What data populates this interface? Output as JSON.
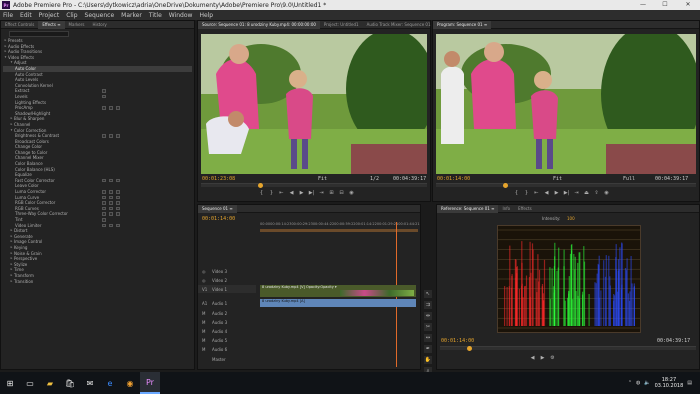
{
  "window": {
    "title": "Adobe Premiere Pro - C:\\Users\\dytkowicz\\adria\\OneDrive\\Dokumenty\\Adobe\\Premiere Pro\\9.0\\Untitled1 *",
    "logo_text": "Pr",
    "minimize": "—",
    "maximize": "☐",
    "close": "✕"
  },
  "menu": [
    "File",
    "Edit",
    "Project",
    "Clip",
    "Sequence",
    "Marker",
    "Title",
    "Window",
    "Help"
  ],
  "effects_panel": {
    "tabs": [
      "Effect Controls",
      "Effects ≡",
      "Markers",
      "History"
    ],
    "active_tab": 1,
    "tree": [
      {
        "label": "Presets",
        "level": 0
      },
      {
        "label": "Audio Effects",
        "level": 0
      },
      {
        "label": "Audio Transitions",
        "level": 0
      },
      {
        "label": "Video Effects",
        "level": 0,
        "open": true
      },
      {
        "label": "Adjust",
        "level": 1,
        "open": true
      },
      {
        "label": "Auto Color",
        "level": 2,
        "selected": true
      },
      {
        "label": "Auto Contrast",
        "level": 2
      },
      {
        "label": "Auto Levels",
        "level": 2
      },
      {
        "label": "Convolution Kernel",
        "level": 2
      },
      {
        "label": "Extract",
        "level": 2,
        "fx": 1
      },
      {
        "label": "Levels",
        "level": 2,
        "fx": 1
      },
      {
        "label": "Lighting Effects",
        "level": 2
      },
      {
        "label": "ProcAmp",
        "level": 2,
        "fx": 3
      },
      {
        "label": "Shadow/Highlight",
        "level": 2
      },
      {
        "label": "Blur & Sharpen",
        "level": 1
      },
      {
        "label": "Channel",
        "level": 1
      },
      {
        "label": "Color Correction",
        "level": 1,
        "open": true
      },
      {
        "label": "Brightness & Contrast",
        "level": 2,
        "fx": 3
      },
      {
        "label": "Broadcast Colors",
        "level": 2
      },
      {
        "label": "Change Color",
        "level": 2
      },
      {
        "label": "Change to Color",
        "level": 2
      },
      {
        "label": "Channel Mixer",
        "level": 2
      },
      {
        "label": "Color Balance",
        "level": 2
      },
      {
        "label": "Color Balance (HLS)",
        "level": 2
      },
      {
        "label": "Equalize",
        "level": 2
      },
      {
        "label": "Fast Color Corrector",
        "level": 2,
        "fx": 3
      },
      {
        "label": "Leave Color",
        "level": 2
      },
      {
        "label": "Luma Corrector",
        "level": 2,
        "fx": 3
      },
      {
        "label": "Luma Curve",
        "level": 2,
        "fx": 3
      },
      {
        "label": "RGB Color Corrector",
        "level": 2,
        "fx": 3
      },
      {
        "label": "RGB Curves",
        "level": 2,
        "fx": 3
      },
      {
        "label": "Three-Way Color Corrector",
        "level": 2,
        "fx": 3
      },
      {
        "label": "Tint",
        "level": 2,
        "fx": 1
      },
      {
        "label": "Video Limiter",
        "level": 2,
        "fx": 3
      },
      {
        "label": "Distort",
        "level": 1
      },
      {
        "label": "Generate",
        "level": 1
      },
      {
        "label": "Image Control",
        "level": 1
      },
      {
        "label": "Keying",
        "level": 1
      },
      {
        "label": "Noise & Grain",
        "level": 1
      },
      {
        "label": "Perspective",
        "level": 1
      },
      {
        "label": "Stylize",
        "level": 1
      },
      {
        "label": "Time",
        "level": 1
      },
      {
        "label": "Transform",
        "level": 1
      },
      {
        "label": "Transition",
        "level": 1
      }
    ]
  },
  "source_monitor": {
    "tabs": [
      "Source: Sequence 01: 8 urodziny Kuby.mp4: 00:00:00:00",
      "Project: Untitled1",
      "Audio Track Mixer: Sequence 01"
    ],
    "timecode": "00:01:23:08",
    "fit": "Fit",
    "ratio": "1/2",
    "duration": "00:04:39:17"
  },
  "program_monitor": {
    "tabs": [
      "Program: Sequence 01 ≡"
    ],
    "timecode": "00:01:14:00",
    "fit": "Fit",
    "ratio": "Full",
    "duration": "00:04:39:17"
  },
  "timeline": {
    "tabs": [
      "Sequence 01 ≡"
    ],
    "timecode": "00:01:14:00",
    "ruler": [
      "00:00",
      "00:00:14:23",
      "00:00:29:23",
      "00:00:44:22",
      "00:00:59:22",
      "00:01:14:22",
      "00:01:29:21",
      "00:01:44:21"
    ],
    "video_tracks": [
      "Video 3",
      "Video 2",
      "Video 1"
    ],
    "audio_tracks": [
      "Audio 1",
      "Audio 2",
      "Audio 3",
      "Audio 4",
      "Audio 5",
      "Audio 6"
    ],
    "master": "Master",
    "v1": "V1",
    "a1": "A1",
    "video_clip": "8 urodziny Kuby.mp4 [V]  Opacity:Opacity ▾",
    "audio_clip": "8 urodziny Kuby.mp4 [A]"
  },
  "scopes": {
    "tabs": [
      "Reference: Sequence 01 ≡",
      "Info",
      "Effects"
    ],
    "intensity_label": "Intensity:",
    "intensity_value": "100",
    "timecode": "00:01:14:00",
    "duration": "00:04:39:17",
    "bars": [
      {
        "color": "#ff2a2a"
      },
      {
        "color": "#2cff3a"
      },
      {
        "color": "#2c4cff"
      }
    ]
  },
  "taskbar": {
    "start_icon": "start-icon",
    "icons": [
      "task-view-icon",
      "file-explorer-icon",
      "store-icon",
      "mail-icon",
      "edge-icon",
      "chrome-icon",
      "premiere-icon"
    ],
    "time": "18:27",
    "date": "03.10.2018"
  }
}
